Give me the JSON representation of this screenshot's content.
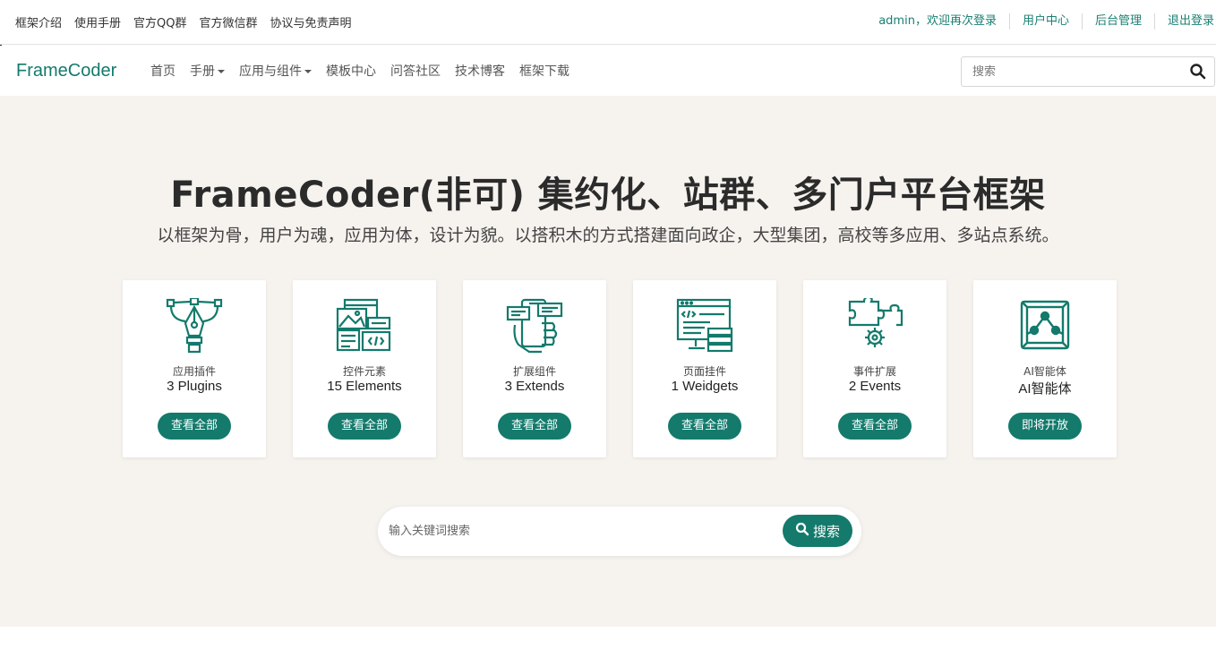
{
  "topbar": {
    "left_links": [
      "框架介绍",
      "使用手册",
      "官方QQ群",
      "官方微信群",
      "协议与免责声明"
    ],
    "welcome": "admin，欢迎再次登录",
    "user_center": "用户中心",
    "admin_panel": "后台管理",
    "logout": "退出登录"
  },
  "navbar": {
    "logo": "FrameCoder",
    "items": [
      {
        "label": "首页",
        "dropdown": false
      },
      {
        "label": "手册",
        "dropdown": true
      },
      {
        "label": "应用与组件",
        "dropdown": true
      },
      {
        "label": "模板中心",
        "dropdown": false
      },
      {
        "label": "问答社区",
        "dropdown": false
      },
      {
        "label": "技术博客",
        "dropdown": false
      },
      {
        "label": "框架下载",
        "dropdown": false
      }
    ],
    "search_placeholder": "搜索"
  },
  "hero": {
    "title": "FrameCoder(非可) 集约化、站群、多门户平台框架",
    "subtitle": "以框架为骨，用户为魂，应用为体，设计为貌。以搭积木的方式搭建面向政企，大型集团，高校等多应用、多站点系统。",
    "cards": [
      {
        "name": "应用插件",
        "count": "3 Plugins",
        "button": "查看全部",
        "icon": "pen-tool-icon"
      },
      {
        "name": "控件元素",
        "count": "15 Elements",
        "button": "查看全部",
        "icon": "ui-elements-icon"
      },
      {
        "name": "扩展组件",
        "count": "3 Extends",
        "button": "查看全部",
        "icon": "phone-extend-icon"
      },
      {
        "name": "页面挂件",
        "count": "1 Weidgets",
        "button": "查看全部",
        "icon": "code-window-icon"
      },
      {
        "name": "事件扩展",
        "count": "2 Events",
        "button": "查看全部",
        "icon": "puzzle-gear-icon"
      },
      {
        "name": "AI智能体",
        "count": "AI智能体",
        "button": "即将开放",
        "icon": "ai-box-icon"
      }
    ],
    "search_placeholder": "输入关键词搜索",
    "search_button": "搜索"
  },
  "colors": {
    "accent": "#137a6c",
    "hero_bg": "#f6f3ef",
    "link_green": "#1a7f73"
  }
}
